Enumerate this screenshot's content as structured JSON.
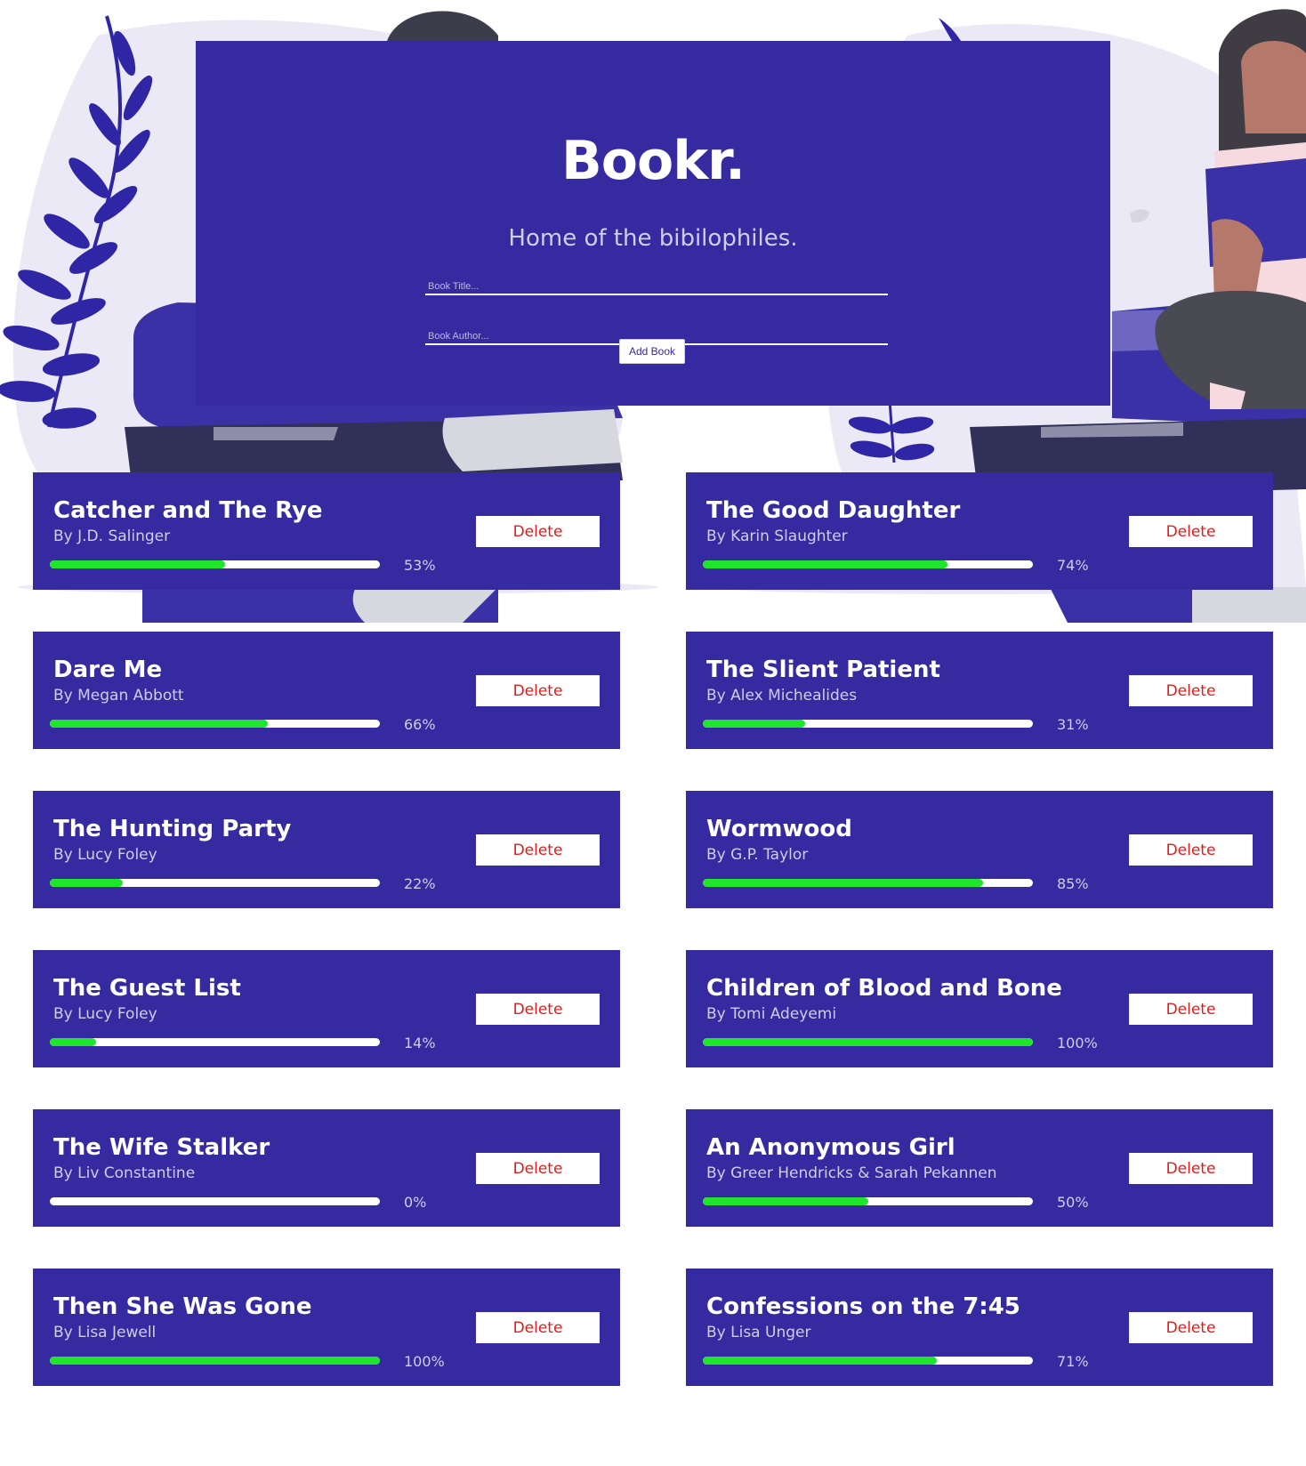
{
  "header": {
    "brand": "Bookr.",
    "tagline": "Home of the bibilophiles.",
    "title_placeholder": "Book Title...",
    "author_placeholder": "Book Author...",
    "add_button": "Add Book"
  },
  "books": [
    {
      "title": "Catcher and The Rye",
      "author": "By J.D. Salinger",
      "progress": 53,
      "progress_label": "53%",
      "delete_label": "Delete"
    },
    {
      "title": "The Good Daughter",
      "author": "By Karin Slaughter",
      "progress": 74,
      "progress_label": "74%",
      "delete_label": "Delete"
    },
    {
      "title": "Dare Me",
      "author": "By Megan Abbott",
      "progress": 66,
      "progress_label": "66%",
      "delete_label": "Delete"
    },
    {
      "title": "The Slient Patient",
      "author": "By Alex Michealides",
      "progress": 31,
      "progress_label": "31%",
      "delete_label": "Delete"
    },
    {
      "title": "The Hunting Party",
      "author": "By Lucy Foley",
      "progress": 22,
      "progress_label": "22%",
      "delete_label": "Delete"
    },
    {
      "title": "Wormwood",
      "author": "By G.P. Taylor",
      "progress": 85,
      "progress_label": "85%",
      "delete_label": "Delete"
    },
    {
      "title": "The Guest List",
      "author": "By Lucy Foley",
      "progress": 14,
      "progress_label": "14%",
      "delete_label": "Delete"
    },
    {
      "title": "Children of Blood and Bone",
      "author": "By Tomi Adeyemi",
      "progress": 100,
      "progress_label": "100%",
      "delete_label": "Delete"
    },
    {
      "title": "The Wife Stalker",
      "author": "By Liv Constantine",
      "progress": 0,
      "progress_label": "0%",
      "delete_label": "Delete"
    },
    {
      "title": "An Anonymous Girl",
      "author": "By Greer Hendricks & Sarah Pekannen",
      "progress": 50,
      "progress_label": "50%",
      "delete_label": "Delete"
    },
    {
      "title": "Then She Was Gone",
      "author": "By Lisa Jewell",
      "progress": 100,
      "progress_label": "100%",
      "delete_label": "Delete"
    },
    {
      "title": "Confessions on the 7:45",
      "author": "By Lisa Unger",
      "progress": 71,
      "progress_label": "71%",
      "delete_label": "Delete"
    }
  ],
  "colors": {
    "panel": "#352a9f",
    "progress_fill": "#1fe62a",
    "delete_text": "#e11b1b",
    "subtle_text": "#cfcde8"
  },
  "icons": [
    "leaf-branch-icon",
    "reading-woman-illustration",
    "book-stack-illustration"
  ]
}
